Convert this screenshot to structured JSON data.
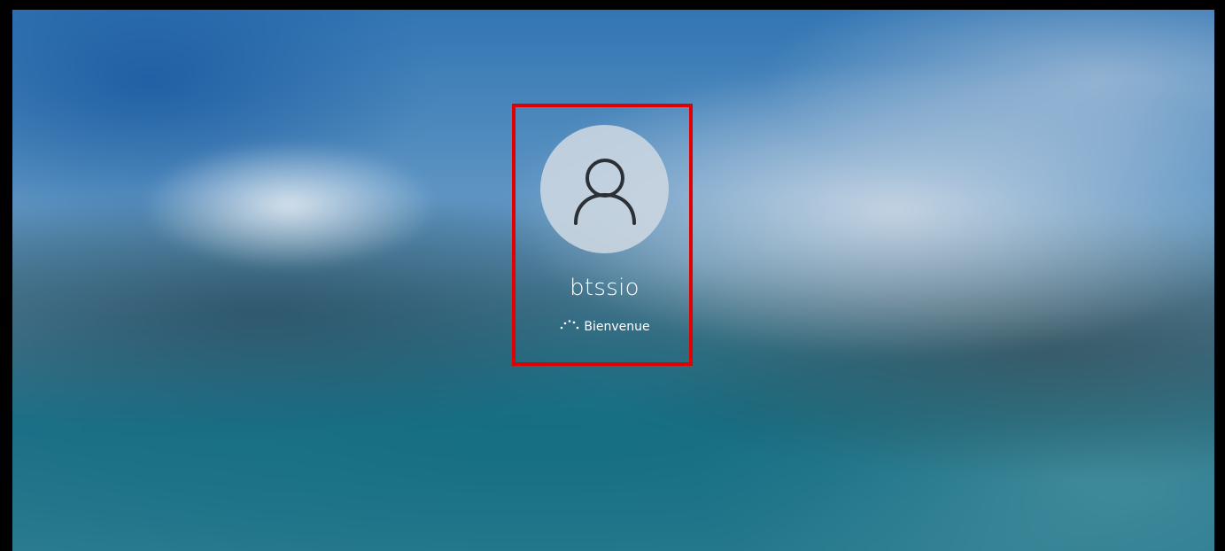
{
  "login": {
    "username": "btssio",
    "status_text": "Bienvenue",
    "avatar_icon": "user-avatar-icon",
    "spinner_icon": "loading-spinner-icon"
  },
  "annotation": {
    "highlight_color": "#e00000"
  }
}
